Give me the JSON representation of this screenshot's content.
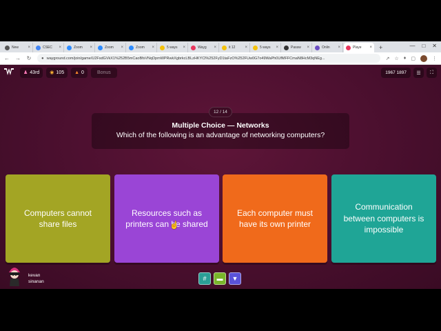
{
  "browser": {
    "tabs": [
      {
        "label": "New",
        "color": "#555555"
      },
      {
        "label": "CSEC",
        "color": "#4285f4"
      },
      {
        "label": "Zoom",
        "color": "#2d8cff"
      },
      {
        "label": "Zoom",
        "color": "#2d8cff"
      },
      {
        "label": "Zoom",
        "color": "#2d8cff"
      },
      {
        "label": "5 ways",
        "color": "#f4c20d"
      },
      {
        "label": "Wayg",
        "color": "#e8365d"
      },
      {
        "label": "it 12",
        "color": "#f4c20d"
      },
      {
        "label": "5 ways",
        "color": "#f4c20d"
      },
      {
        "label": "Passw",
        "color": "#333333"
      },
      {
        "label": "Onlin",
        "color": "#6a4cc2"
      },
      {
        "label": "Playe",
        "color": "#e8365d"
      }
    ],
    "url": "wayground.com/join/game/U2FsdGVkX1%252B5mCaoBfsVNqDpmWPRwkXgbrkcLBLzHKYCl%252FyD1taFzO%252FUw0G7o49WaPh0UfMFFCmaN8HcM3qNEg..."
  },
  "topbar": {
    "rank": "43rd",
    "score": "105",
    "streak": "0",
    "bonus": "Bonus",
    "game_code": "1967 1897"
  },
  "question": {
    "counter": "12 / 14",
    "type": "Multiple Choice — Networks",
    "text": "Which of the following is an advantage of networking computers?"
  },
  "options": [
    {
      "label": "Computers cannot share files",
      "color": "#a3a524"
    },
    {
      "label": "Resources such as printers can be shared",
      "color": "#9a45d6"
    },
    {
      "label": "Each computer must have its own printer",
      "color": "#f06a1b"
    },
    {
      "label": "Communication between computers is impossible",
      "color": "#1fa596"
    }
  ],
  "player": {
    "name_line1": "kevan",
    "name_line2": "sinanan"
  },
  "powerups": [
    {
      "icon": "grid-icon",
      "color": "#2b9e96"
    },
    {
      "icon": "eraser-icon",
      "color": "#79b52a"
    },
    {
      "icon": "shoe-icon",
      "color": "#5a52d8"
    }
  ]
}
